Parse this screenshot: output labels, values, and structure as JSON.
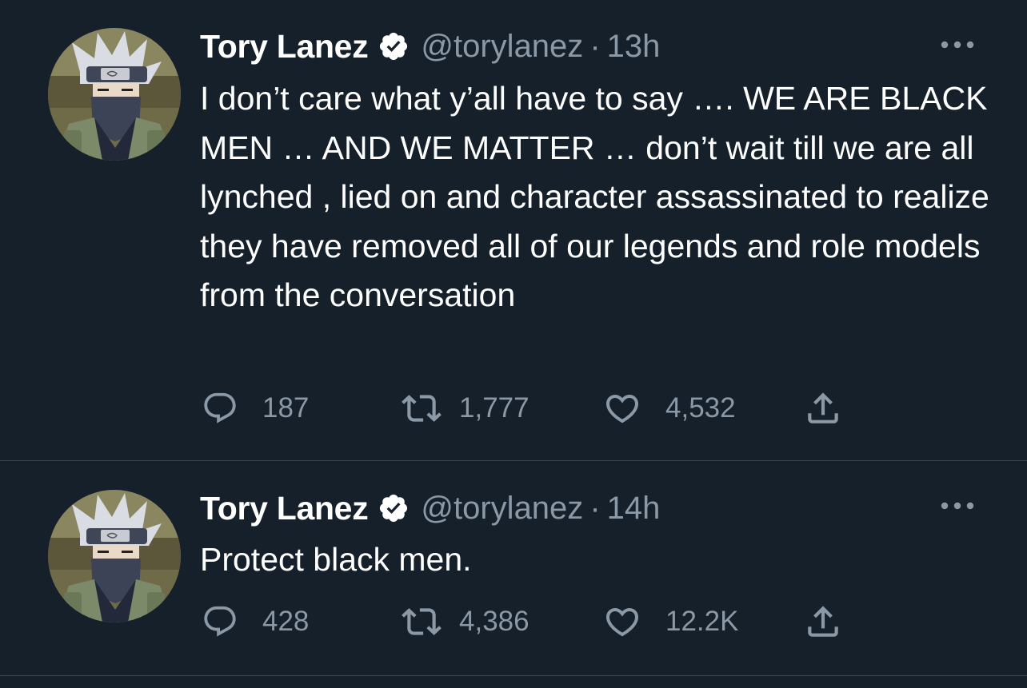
{
  "tweets": [
    {
      "display_name": "Tory Lanez",
      "handle": "@torylanez",
      "separator": "·",
      "time": "13h",
      "text": "I don’t care what y’all have to say …. WE ARE BLACK MEN … AND WE MATTER … don’t wait till we are all lynched , lied on and character assassinated to realize they have removed all of our legends and role models from the conversation",
      "replies": "187",
      "retweets": "1,777",
      "likes": "4,532"
    },
    {
      "display_name": "Tory Lanez",
      "handle": "@torylanez",
      "separator": "·",
      "time": "14h",
      "text": "Protect black men.",
      "replies": "428",
      "retweets": "4,386",
      "likes": "12.2K"
    }
  ],
  "icons": {
    "verified": "verified-badge-icon",
    "more": "more-options-icon",
    "reply": "reply-icon",
    "retweet": "retweet-icon",
    "like": "heart-icon",
    "share": "share-icon"
  },
  "colors": {
    "background": "#15202b",
    "primary_text": "#ffffff",
    "secondary_text": "#8b98a5",
    "divider": "#38444d",
    "verified_badge": "#ffffff"
  }
}
